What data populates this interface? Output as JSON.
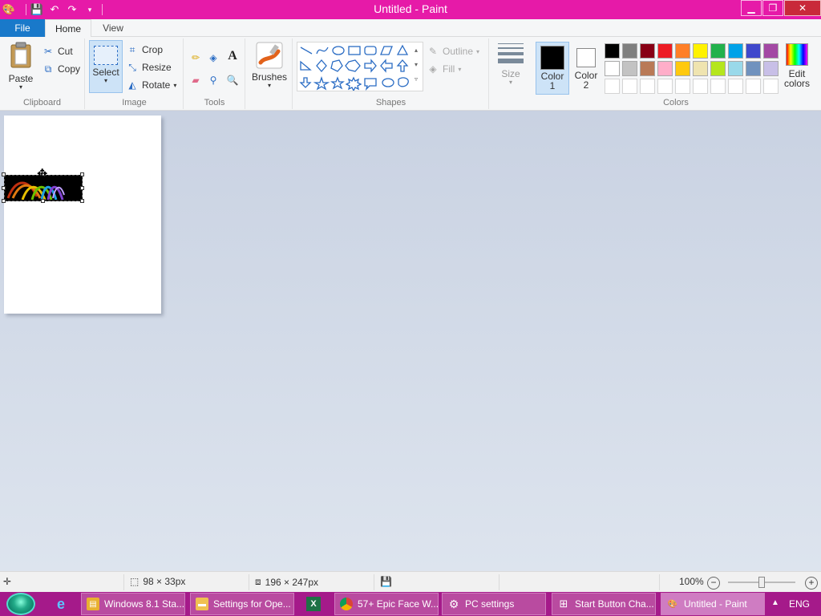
{
  "window": {
    "title": "Untitled - Paint"
  },
  "tabs": {
    "file": "File",
    "home": "Home",
    "view": "View"
  },
  "clipboard": {
    "paste": "Paste",
    "cut": "Cut",
    "copy": "Copy",
    "label": "Clipboard"
  },
  "image": {
    "select": "Select",
    "crop": "Crop",
    "resize": "Resize",
    "rotate": "Rotate",
    "label": "Image"
  },
  "tools": {
    "label": "Tools"
  },
  "brushes": {
    "label": "Brushes"
  },
  "shapes": {
    "label": "Shapes",
    "outline": "Outline",
    "fill": "Fill"
  },
  "size": {
    "label": "Size"
  },
  "colors": {
    "color1": "Color",
    "color1_num": "1",
    "color2": "Color",
    "color2_num": "2",
    "edit_line1": "Edit",
    "edit_line2": "colors",
    "label": "Colors",
    "color1_value": "#000000",
    "color2_value": "#ffffff",
    "palette_row1": [
      "#000000",
      "#7f7f7f",
      "#880015",
      "#ed1c24",
      "#ff7f27",
      "#fff200",
      "#22b14c",
      "#00a2e8",
      "#3f48cc",
      "#a349a4"
    ],
    "palette_row2": [
      "#ffffff",
      "#c3c3c3",
      "#b97a57",
      "#ffaec9",
      "#ffc90e",
      "#efe4b0",
      "#b5e61d",
      "#99d9ea",
      "#7092be",
      "#c8bfe7"
    ]
  },
  "status": {
    "selection_size": "98 × 33px",
    "canvas_size": "196 × 247px",
    "zoom": "100%"
  },
  "taskbar": {
    "items": [
      {
        "label": "Windows 8.1 Sta..."
      },
      {
        "label": "Settings for Ope..."
      },
      {
        "label": "57+ Epic Face W..."
      },
      {
        "label": "PC settings"
      },
      {
        "label": "Start Button Cha..."
      },
      {
        "label": "Untitled - Paint"
      }
    ],
    "lang": "ENG"
  }
}
